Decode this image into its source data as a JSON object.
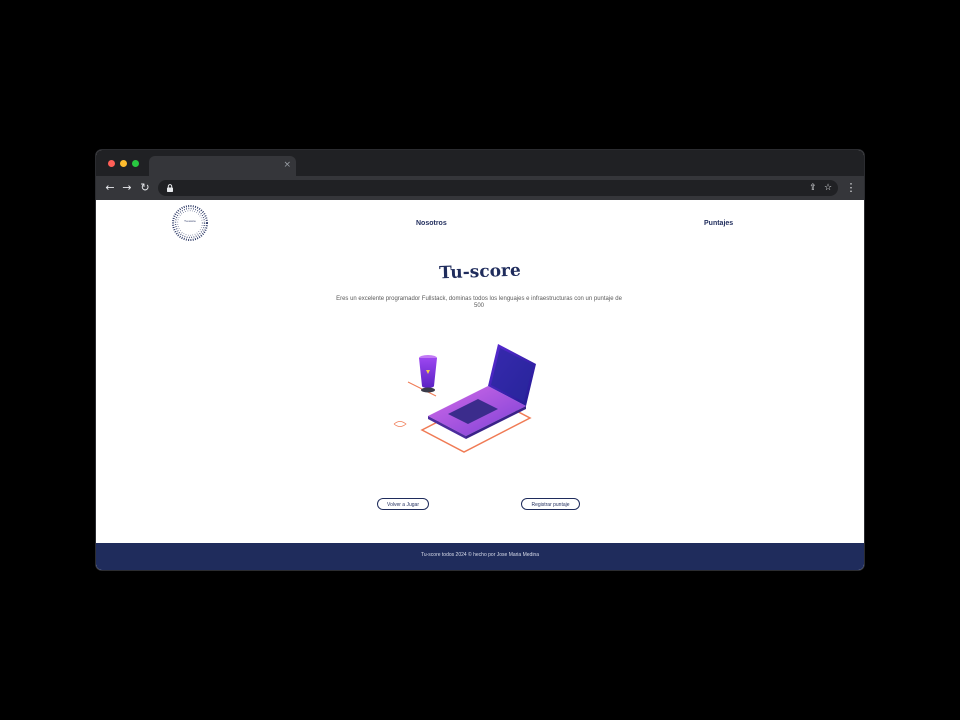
{
  "browser": {
    "tab_title": "",
    "tab_close": "×",
    "url": "",
    "icons": [
      "back-arrow-icon",
      "forward-arrow-icon",
      "reload-icon",
      "lock-icon",
      "share-icon",
      "star-icon",
      "menu-dots-icon"
    ]
  },
  "nav": {
    "logo_text": "Tu-score",
    "nosotros": "Nosotros",
    "puntajes": "Puntajes"
  },
  "hero": {
    "title": "Tu-score",
    "description": "Eres un excelente programador Fullstack, dominas todos los lenguajes e infraestructuras con un puntaje de 500"
  },
  "actions": {
    "play_again": "Volver a Jugar",
    "register_score": "Registrar puntaje"
  },
  "footer": {
    "text": "Tu-score todos 2024 © hecho por Jose Maria Medina"
  },
  "colors": {
    "brand": "#1f2c5c",
    "browser_chrome": "#202124",
    "toolbar": "#35363a"
  }
}
